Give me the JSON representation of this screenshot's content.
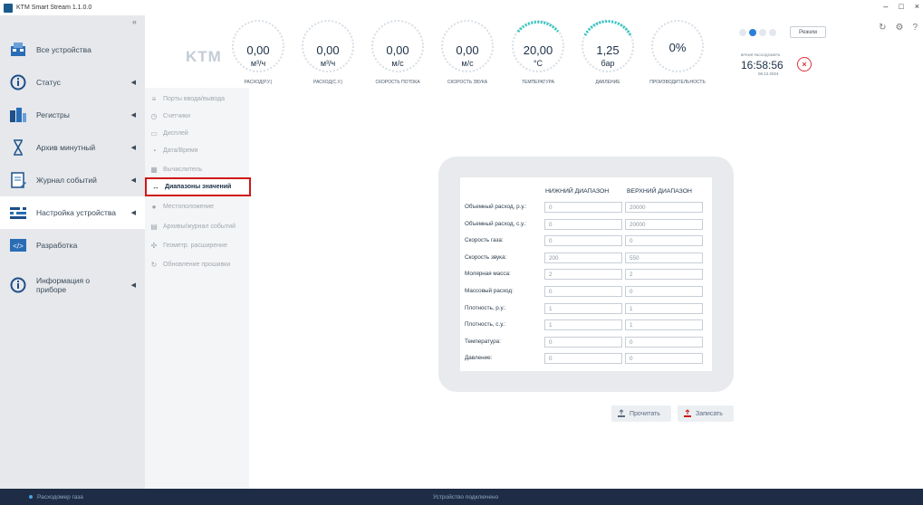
{
  "window": {
    "title": "KTM Smart Stream 1.1.0.0",
    "controls": [
      "–",
      "□",
      "×"
    ]
  },
  "sidebar": {
    "collapse_glyph": "«",
    "items": [
      {
        "label": "Все устройства",
        "icon": "devices-icon"
      },
      {
        "label": "Статус",
        "icon": "info-icon"
      },
      {
        "label": "Регистры",
        "icon": "registers-icon"
      },
      {
        "label": "Архив минутный",
        "icon": "hourglass-icon"
      },
      {
        "label": "Журнал событий",
        "icon": "journal-icon"
      },
      {
        "label": "Настройка устройства",
        "icon": "settings-sliders-icon"
      },
      {
        "label": "Разработка",
        "icon": "code-icon"
      },
      {
        "label": "Информация о приборе",
        "icon": "info-icon"
      }
    ]
  },
  "submenu": {
    "items": [
      {
        "label": "Порты ввода/вывода",
        "icon": "ports-icon"
      },
      {
        "label": "Счетчики",
        "icon": "counter-icon"
      },
      {
        "label": "Дисплей",
        "icon": "display-icon"
      },
      {
        "label": "Дата/Время",
        "icon": "clock-icon"
      },
      {
        "label": "Вычислитель",
        "icon": "calculator-icon"
      },
      {
        "label": "Диапазоны значений",
        "icon": "range-icon"
      },
      {
        "label": "Местоположение",
        "icon": "location-icon"
      },
      {
        "label": "Архивы/журнал событий",
        "icon": "archive-icon"
      },
      {
        "label": "Геометр. расширение",
        "icon": "geometry-icon"
      },
      {
        "label": "Обновление прошивки",
        "icon": "update-icon"
      }
    ],
    "selected_index": 5
  },
  "header": {
    "logo": "KTM",
    "gauges": [
      {
        "value": "0,00",
        "unit": "м³/ч",
        "label": "РАСХОД(Р.У.)"
      },
      {
        "value": "0,00",
        "unit": "м³/ч",
        "label": "РАСХОД(С.У.)"
      },
      {
        "value": "0,00",
        "unit": "м/с",
        "label": "СКОРОСТЬ ПОТОКА"
      },
      {
        "value": "0,00",
        "unit": "м/с",
        "label": "СКОРОСТЬ ЗВУКА"
      },
      {
        "value": "20,00",
        "unit": "°C",
        "label": "ТЕМПЕРАТУРА"
      },
      {
        "value": "1,25",
        "unit": "бар",
        "label": "ДАВЛЕНИЕ"
      },
      {
        "value": "0%",
        "unit": "",
        "label": "ПРОИЗВОДИТЕЛЬНОСТЬ"
      }
    ],
    "mode_button": "Режим",
    "time_label": "ВРЕМЯ РАСХОДОМЕРА",
    "time": "16:58:56",
    "date": "06.12.2024"
  },
  "ranges": {
    "col_lower": "НИЖНИЙ ДИАПАЗОН",
    "col_upper": "ВЕРХНИЙ ДИАПАЗОН",
    "rows": [
      {
        "label": "Объемный расход, р.у.:",
        "lower": "0",
        "upper": "20000"
      },
      {
        "label": "Объемный расход, с.у.:",
        "lower": "0",
        "upper": "20000"
      },
      {
        "label": "Скорость газа:",
        "lower": "0",
        "upper": "0"
      },
      {
        "label": "Скорость звука:",
        "lower": "200",
        "upper": "550"
      },
      {
        "label": "Молярная масса:",
        "lower": "2",
        "upper": "2"
      },
      {
        "label": "Массовый расход:",
        "lower": "0",
        "upper": "0"
      },
      {
        "label": "Плотность, р.у.:",
        "lower": "1",
        "upper": "1"
      },
      {
        "label": "Плотность, с.у.:",
        "lower": "1",
        "upper": "1"
      },
      {
        "label": "Температура:",
        "lower": "0",
        "upper": "0"
      },
      {
        "label": "Давление:",
        "lower": "0",
        "upper": "0"
      }
    ]
  },
  "actions": {
    "read": "Прочитать",
    "write": "Записать"
  },
  "status": {
    "left": "Расходомер газа",
    "center": "Устройство подключено"
  },
  "colors": {
    "accent_blue": "#2c7fd8",
    "status_bg": "#1e2d45",
    "selection_red": "#d01818"
  }
}
